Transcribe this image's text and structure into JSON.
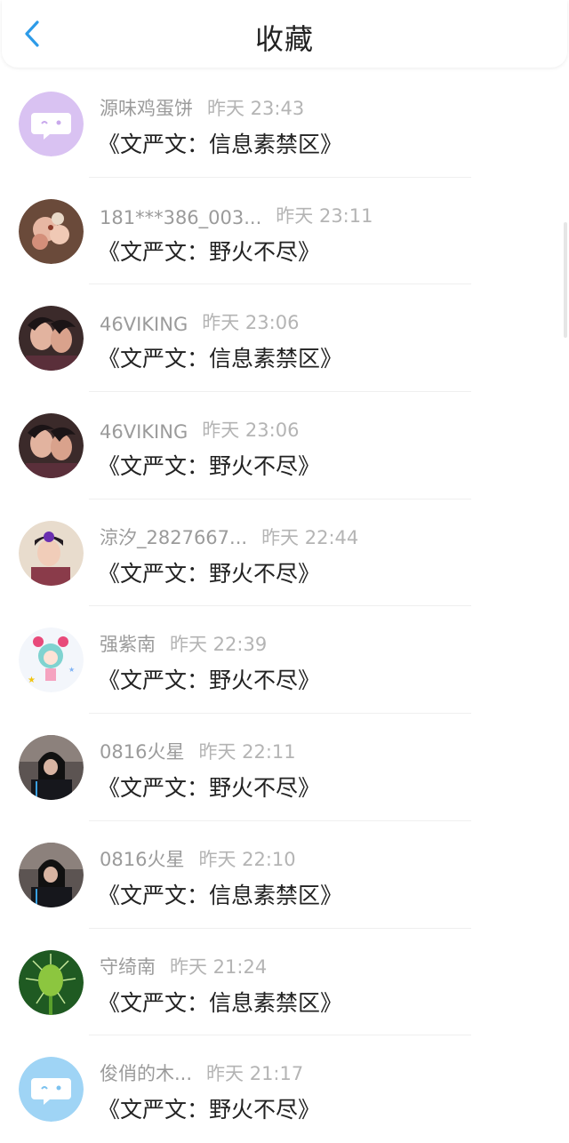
{
  "header": {
    "title": "收藏",
    "back_icon": "chevron-left-icon",
    "accent": "#2d9be8"
  },
  "items": [
    {
      "name": "源味鸡蛋饼",
      "time": "昨天 23:43",
      "message": "《文严文：信息素禁区》",
      "avatar": "default-chat-avatar",
      "avatar_color": "#d9c2f2"
    },
    {
      "name": "181***386_003...",
      "time": "昨天 23:11",
      "message": "《文严文：野火不尽》",
      "avatar": "photo-avatar"
    },
    {
      "name": "46VIKING",
      "time": "昨天 23:06",
      "message": "《文严文：信息素禁区》",
      "avatar": "photo-avatar"
    },
    {
      "name": "46VIKING",
      "time": "昨天 23:06",
      "message": "《文严文：野火不尽》",
      "avatar": "photo-avatar"
    },
    {
      "name": "涼汐_2827667...",
      "time": "昨天 22:44",
      "message": "《文严文：野火不尽》",
      "avatar": "photo-avatar"
    },
    {
      "name": "强紫南",
      "time": "昨天 22:39",
      "message": "《文严文：野火不尽》",
      "avatar": "cartoon-avatar"
    },
    {
      "name": "0816火星",
      "time": "昨天 22:11",
      "message": "《文严文：野火不尽》",
      "avatar": "photo-avatar"
    },
    {
      "name": "0816火星",
      "time": "昨天 22:10",
      "message": "《文严文：信息素禁区》",
      "avatar": "photo-avatar"
    },
    {
      "name": "守绮南",
      "time": "昨天 21:24",
      "message": "《文严文：信息素禁区》",
      "avatar": "plant-photo-avatar"
    },
    {
      "name": "俊俏的木...",
      "time": "昨天 21:17",
      "message": "《文严文：野火不尽》",
      "avatar": "default-chat-avatar",
      "avatar_color": "#9fd4f5"
    }
  ]
}
